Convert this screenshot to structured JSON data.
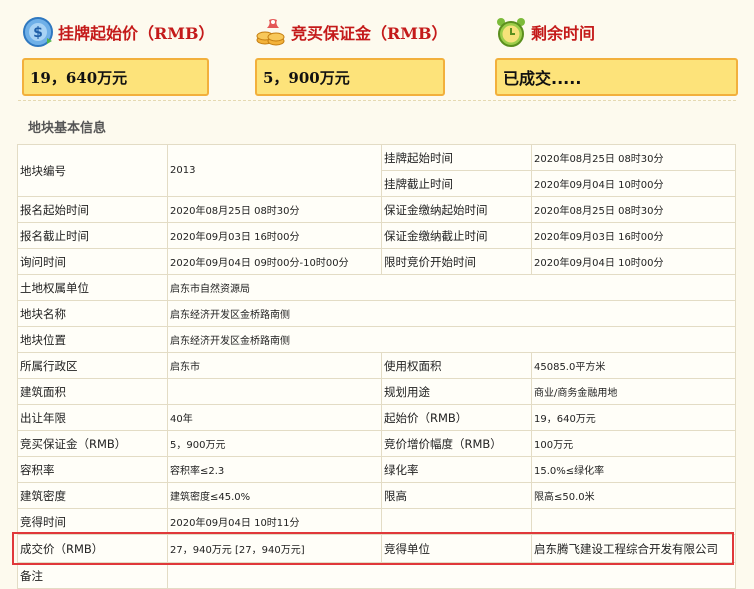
{
  "summary": {
    "start_price_label": "挂牌起始价（RMB）",
    "start_price_value": "19，640万元",
    "deposit_label": "竞买保证金（RMB）",
    "deposit_value": "5，900万元",
    "remaining_label": "剩余时间",
    "remaining_value": "已成交....."
  },
  "section_title": "地块基本信息",
  "table": {
    "r1": {
      "k1": "地块编号",
      "v1": "2013",
      "k2": "挂牌起始时间",
      "v2": "2020年08月25日 08时30分"
    },
    "r2": {
      "k2": "挂牌截止时间",
      "v2": "2020年09月04日 10时00分"
    },
    "r3": {
      "k1": "报名起始时间",
      "v1": "2020年08月25日 08时30分",
      "k2": "保证金缴纳起始时间",
      "v2": "2020年08月25日 08时30分"
    },
    "r4": {
      "k1": "报名截止时间",
      "v1": "2020年09月03日 16时00分",
      "k2": "保证金缴纳截止时间",
      "v2": "2020年09月03日 16时00分"
    },
    "r5": {
      "k1": "询问时间",
      "v1": "2020年09月04日 09时00分-10时00分",
      "k2": "限时竞价开始时间",
      "v2": "2020年09月04日 10时00分"
    },
    "r6": {
      "k1": "土地权属单位",
      "v1": "启东市自然资源局"
    },
    "r7": {
      "k1": "地块名称",
      "v1": "启东经济开发区金桥路南侧"
    },
    "r8": {
      "k1": "地块位置",
      "v1": "启东经济开发区金桥路南侧"
    },
    "r9": {
      "k1": "所属行政区",
      "v1": "启东市",
      "k2": "使用权面积",
      "v2": "45085.0平方米"
    },
    "r10": {
      "k1": "建筑面积",
      "v1": "",
      "k2": "规划用途",
      "v2": "商业/商务金融用地"
    },
    "r11": {
      "k1": "出让年限",
      "v1": "40年",
      "k2": "起始价（RMB）",
      "v2": "19，640万元"
    },
    "r12": {
      "k1": "竞买保证金（RMB）",
      "v1": "5，900万元",
      "k2": "竞价增价幅度（RMB）",
      "v2": "100万元"
    },
    "r13": {
      "k1": "容积率",
      "v1": "容积率≤2.3",
      "k2": "绿化率",
      "v2": "15.0%≤绿化率"
    },
    "r14": {
      "k1": "建筑密度",
      "v1": "建筑密度≤45.0%",
      "k2": "限高",
      "v2": "限高≤50.0米"
    },
    "r15": {
      "k1": "竞得时间",
      "v1": "2020年09月04日 10时11分",
      "k2": "",
      "v2": ""
    },
    "r16": {
      "k1": "成交价（RMB）",
      "v1": "27，940万元 [27，940万元]",
      "k2": "竞得单位",
      "v2": "启东腾飞建设工程综合开发有限公司"
    },
    "r17": {
      "k1": "备注",
      "v1": ""
    }
  },
  "icons": {
    "start_price": "dollar-coin-icon",
    "deposit": "coins-stack-icon",
    "remaining": "alarm-clock-icon"
  },
  "colors": {
    "label_red": "#c41a1a",
    "value_box_fill": "#fde37a",
    "value_box_border": "#f2b03c",
    "highlight_border": "#e0383a"
  }
}
